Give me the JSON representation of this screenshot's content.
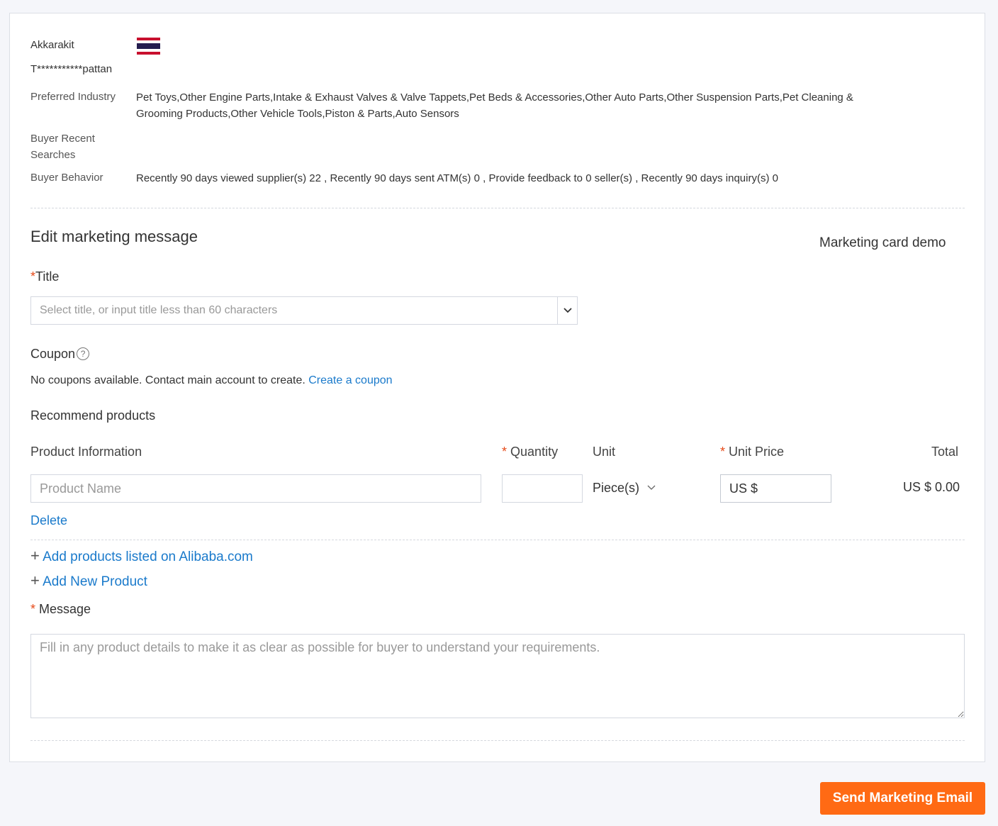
{
  "buyer": {
    "first_name": "Akkarakit",
    "last_name": "T***********pattan",
    "country_flag": "thailand-flag-icon",
    "preferred_industry_label": "Preferred Industry",
    "preferred_industry_line1": "Pet Toys,Other Engine Parts,Intake & Exhaust Valves & Valve Tappets,Pet Beds & Accessories,Other Auto Parts,Other Suspension Parts,Pet Cleaning &",
    "preferred_industry_line2": "Grooming Products,Other Vehicle Tools,Piston & Parts,Auto Sensors",
    "recent_searches_label_1": "Buyer Recent",
    "recent_searches_label_2": "Searches",
    "behavior_label": "Buyer Behavior",
    "behavior_value": "Recently 90 days viewed supplier(s) 22 , Recently 90 days sent ATM(s) 0 , Provide feedback to 0 seller(s) , Recently 90 days inquiry(s) 0"
  },
  "form": {
    "heading": "Edit marketing message",
    "demo_link": "Marketing card demo",
    "title_required": "*",
    "title_label": "Title",
    "title_placeholder": "Select title, or input title less than 60 characters",
    "coupon_label": "Coupon",
    "coupon_help": "?",
    "coupon_text": "No coupons available. Contact main account to create.",
    "coupon_link": "Create a coupon",
    "recommend_heading": "Recommend products",
    "columns": {
      "product_info": "Product Information",
      "quantity_required": "*",
      "quantity": "Quantity",
      "unit": "Unit",
      "unit_price_required": "*",
      "unit_price": "Unit Price",
      "total": "Total"
    },
    "product_row": {
      "name_placeholder": "Product Name",
      "quantity_value": "",
      "unit_value": "Piece(s)",
      "price_prefix": "US $",
      "total": "US $ 0.00",
      "delete": "Delete"
    },
    "add_listed": "Add products listed on Alibaba.com",
    "add_new": "Add New Product",
    "message_required": "*",
    "message_label": "Message",
    "message_placeholder": "Fill in any product details to make it as clear as possible for buyer to understand your requirements."
  },
  "actions": {
    "send": "Send Marketing Email"
  },
  "colors": {
    "accent": "#ff6a14",
    "link": "#1a7acb",
    "required": "#e64a19"
  }
}
